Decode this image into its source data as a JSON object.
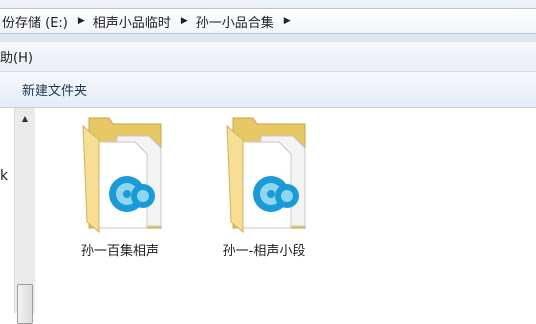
{
  "address": {
    "crumbs": [
      {
        "label": "份存储 (E:)"
      },
      {
        "label": "相声小品临时"
      },
      {
        "label": "孙一小品合集"
      }
    ]
  },
  "menubar": {
    "items": [
      {
        "label": "助(H)"
      }
    ]
  },
  "toolbar": {
    "new_folder_label": "新建文件夹"
  },
  "navpane": {
    "partial_label": "k"
  },
  "folders": [
    {
      "label": "孙一百集相声",
      "icon": "media-folder-icon"
    },
    {
      "label": "孙一-相声小段",
      "icon": "media-folder-icon"
    }
  ],
  "colors": {
    "folder_back": "#e8c765",
    "folder_front": "#f6df94",
    "media_blue": "#1a9ad6"
  }
}
